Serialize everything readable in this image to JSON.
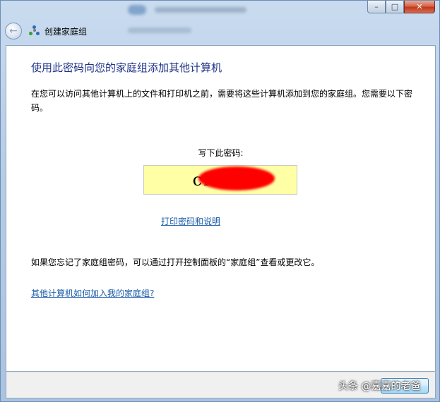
{
  "window": {
    "caption": {
      "minimize": "–",
      "maximize": "□",
      "close": "✕"
    }
  },
  "nav": {
    "title": "创建家庭组"
  },
  "main": {
    "heading": "使用此密码向您的家庭组添加其他计算机",
    "paragraph": "在您可以访问其他计算机上的文件和打印机之前，需要将这些计算机添加到您的家庭组。您需要以下密码。",
    "password_label": "写下此密码:",
    "password_visible": "ci8          W",
    "print_link": "打印密码和说明",
    "forgot_text": "如果您忘记了家庭组密码，可以通过打开控制面板的“家庭组”查看或更改它。",
    "join_link": "其他计算机如何加入我的家庭组?"
  },
  "overlay": {
    "watermark": "头条 @嘉嘉的老爸"
  },
  "colors": {
    "heading": "#1e3287",
    "link": "#1a5aa8",
    "password_bg": "#ffffa6",
    "redaction": "#ff0000"
  }
}
